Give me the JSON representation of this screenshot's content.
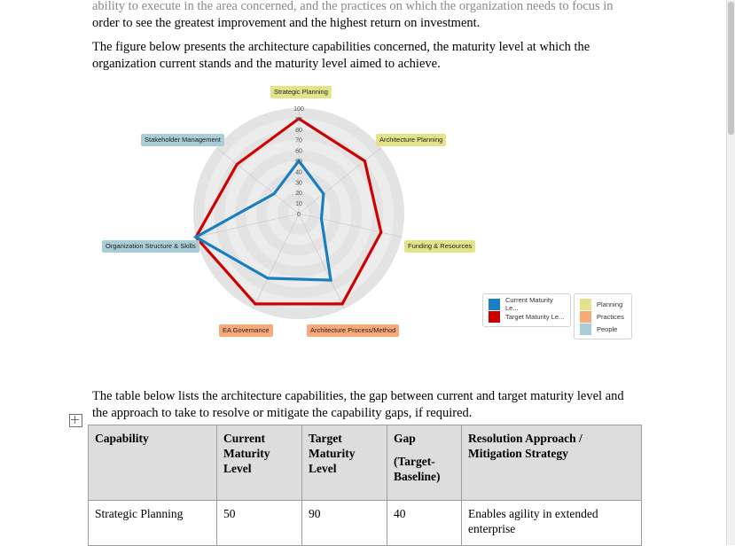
{
  "document": {
    "paragraph_1_faded": "ability to execute in the area concerned, and the practices on which the organization needs to focus in",
    "paragraph_1_line2": "order to see the greatest improvement and the highest return on investment.",
    "paragraph_2": "The figure below presents the architecture capabilities concerned, the maturity level at which the organization current stands and the maturity level aimed to achieve.",
    "paragraph_3": "The table below lists the architecture capabilities, the gap between current and target maturity level and the approach to take to resolve or mitigate the capability gaps, if required."
  },
  "chart_data": {
    "type": "radar",
    "title": "",
    "categories": [
      "Strategic Planning",
      "Architecture Planning",
      "Funding & Resources",
      "Architecture Process/Method",
      "EA Governance",
      "Organization Structure & Skills",
      "Stakeholder Management"
    ],
    "category_groups": [
      "Planning",
      "Planning",
      "Planning",
      "Practices",
      "Practices",
      "People",
      "People"
    ],
    "series": [
      {
        "name": "Current Maturity Le...",
        "color": "#1a7fc1",
        "values": [
          50,
          30,
          22,
          70,
          68,
          100,
          30
        ]
      },
      {
        "name": "Target Maturity Le...",
        "color": "#cc0000",
        "values": [
          90,
          80,
          80,
          95,
          95,
          100,
          75
        ]
      }
    ],
    "tick_labels": [
      "0",
      "10",
      "20",
      "30",
      "40",
      "50",
      "60",
      "70",
      "80",
      "90",
      "100"
    ],
    "ylim": [
      0,
      100
    ],
    "grid": true,
    "legend_position": "right"
  },
  "legend_series": {
    "title": "",
    "items": [
      {
        "label": "Current Maturity Le...",
        "color": "#1a7fc1"
      },
      {
        "label": "Target Maturity Le...",
        "color": "#cc0000"
      }
    ]
  },
  "legend_groups": {
    "items": [
      {
        "label": "Planning",
        "color": "#e3e48a"
      },
      {
        "label": "Practices",
        "color": "#f9a977"
      },
      {
        "label": "People",
        "color": "#a9cdd6"
      }
    ]
  },
  "table": {
    "headers": {
      "capability": "Capability",
      "current": "Current Maturity Level",
      "target": "Target Maturity Level",
      "gap": "Gap",
      "gap_sub": "(Target-Baseline)",
      "resolution": "Resolution Approach / Mitigation Strategy"
    },
    "rows": [
      {
        "capability": "Strategic Planning",
        "current": "50",
        "target": "90",
        "gap": "40",
        "resolution": "Enables agility in extended enterprise"
      }
    ]
  }
}
